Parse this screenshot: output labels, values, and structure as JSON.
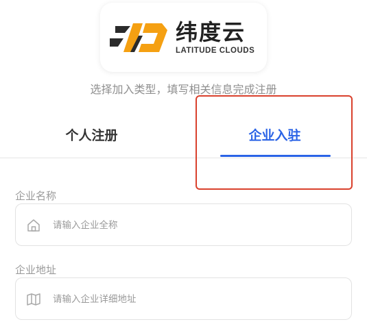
{
  "brand": {
    "name_cn": "纬度云",
    "name_en": "LATITUDE CLOUDS",
    "colors": {
      "orange": "#f5a012",
      "dark": "#2b2b2b"
    }
  },
  "subtitle": "选择加入类型，填写相关信息完成注册",
  "tabs": [
    {
      "label": "个人注册",
      "active": false
    },
    {
      "label": "企业入驻",
      "active": true
    }
  ],
  "accent_color": "#2a63e6",
  "highlight_color": "#d9402c",
  "form": {
    "company_name": {
      "label": "企业名称",
      "placeholder": "请输入企业全称",
      "value": "",
      "icon": "home-icon"
    },
    "company_address": {
      "label": "企业地址",
      "placeholder": "请输入企业详细地址",
      "value": "",
      "icon": "map-icon"
    }
  }
}
